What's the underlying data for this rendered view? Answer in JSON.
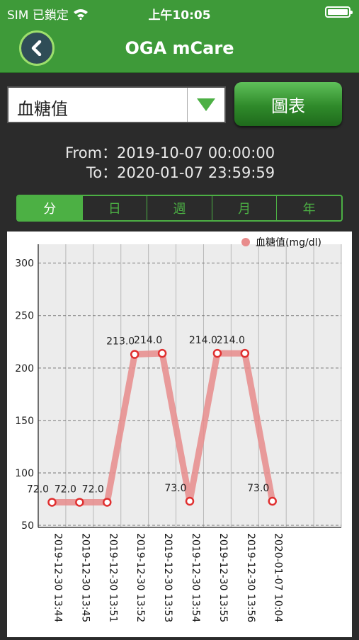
{
  "status": {
    "carrier": "SIM 已鎖定",
    "time": "上午10:05"
  },
  "nav": {
    "title": "OGA mCare"
  },
  "selector": {
    "value": "血糖值",
    "chart_button": "圖表"
  },
  "range": {
    "from": "From：2019-10-07 00:00:00",
    "to": "To：2020-01-07 23:59:59"
  },
  "tabs": [
    "分",
    "日",
    "週",
    "月",
    "年"
  ],
  "active_tab": 0,
  "colors": {
    "accent": "#4cb044",
    "series": "#e88c8c",
    "marker": "#e03030"
  },
  "chart_data": {
    "type": "line",
    "legend": "血糖值(mg/dl)",
    "legend_position": "top-right",
    "categories": [
      "2019-12-30 13:44",
      "2019-12-30 13:45",
      "2019-12-30 13:51",
      "2019-12-30 13:52",
      "2019-12-30 13:53",
      "2019-12-30 13:54",
      "2019-12-30 13:55",
      "2019-12-30 13:56",
      "2020-01-07 10:04"
    ],
    "values": [
      72.0,
      72.0,
      72.0,
      213.0,
      214.0,
      73.0,
      214.0,
      214.0,
      73.0
    ],
    "value_labels": [
      "72.0",
      "72.0",
      "72.0",
      "213.0",
      "214.0",
      "73.0",
      "214.0",
      "214.0",
      "73.0"
    ],
    "y_ticks": [
      "300",
      "250",
      "200",
      "150",
      "100",
      "50"
    ],
    "ylim": [
      48,
      318
    ],
    "grid": true
  }
}
